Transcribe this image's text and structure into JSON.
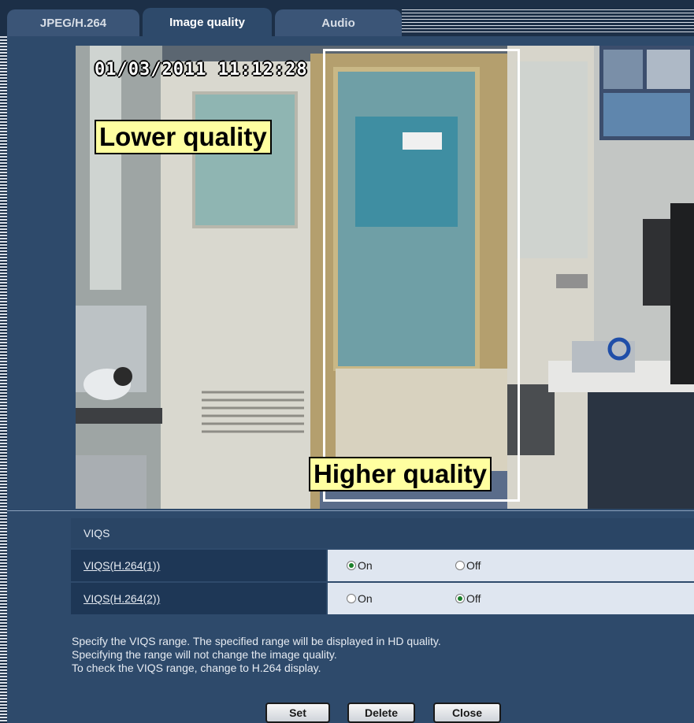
{
  "tabs": [
    {
      "label": "JPEG/H.264",
      "active": false
    },
    {
      "label": "Image quality",
      "active": true
    },
    {
      "label": "Audio",
      "active": false
    }
  ],
  "camera": {
    "timestamp": "01/03/2011  11:12:28",
    "lower_quality_label": "Lower quality",
    "higher_quality_label": "Higher quality"
  },
  "viqs": {
    "header": "VIQS",
    "rows": [
      {
        "label": "VIQS(H.264(1))",
        "on_label": "On",
        "off_label": "Off",
        "selected": "On"
      },
      {
        "label": "VIQS(H.264(2))",
        "on_label": "On",
        "off_label": "Off",
        "selected": "Off"
      }
    ]
  },
  "help_lines": [
    "Specify the VIQS range. The specified range will be displayed in HD quality.",
    "Specifying the range will not change the image quality.",
    "To check the VIQS range, change to H.264 display."
  ],
  "buttons": {
    "set": "Set",
    "delete": "Delete",
    "close": "Close"
  },
  "colors": {
    "background": "#2e4a6b",
    "label_fill": "#ffffa0",
    "radio_checked": "#1a7f2a"
  }
}
